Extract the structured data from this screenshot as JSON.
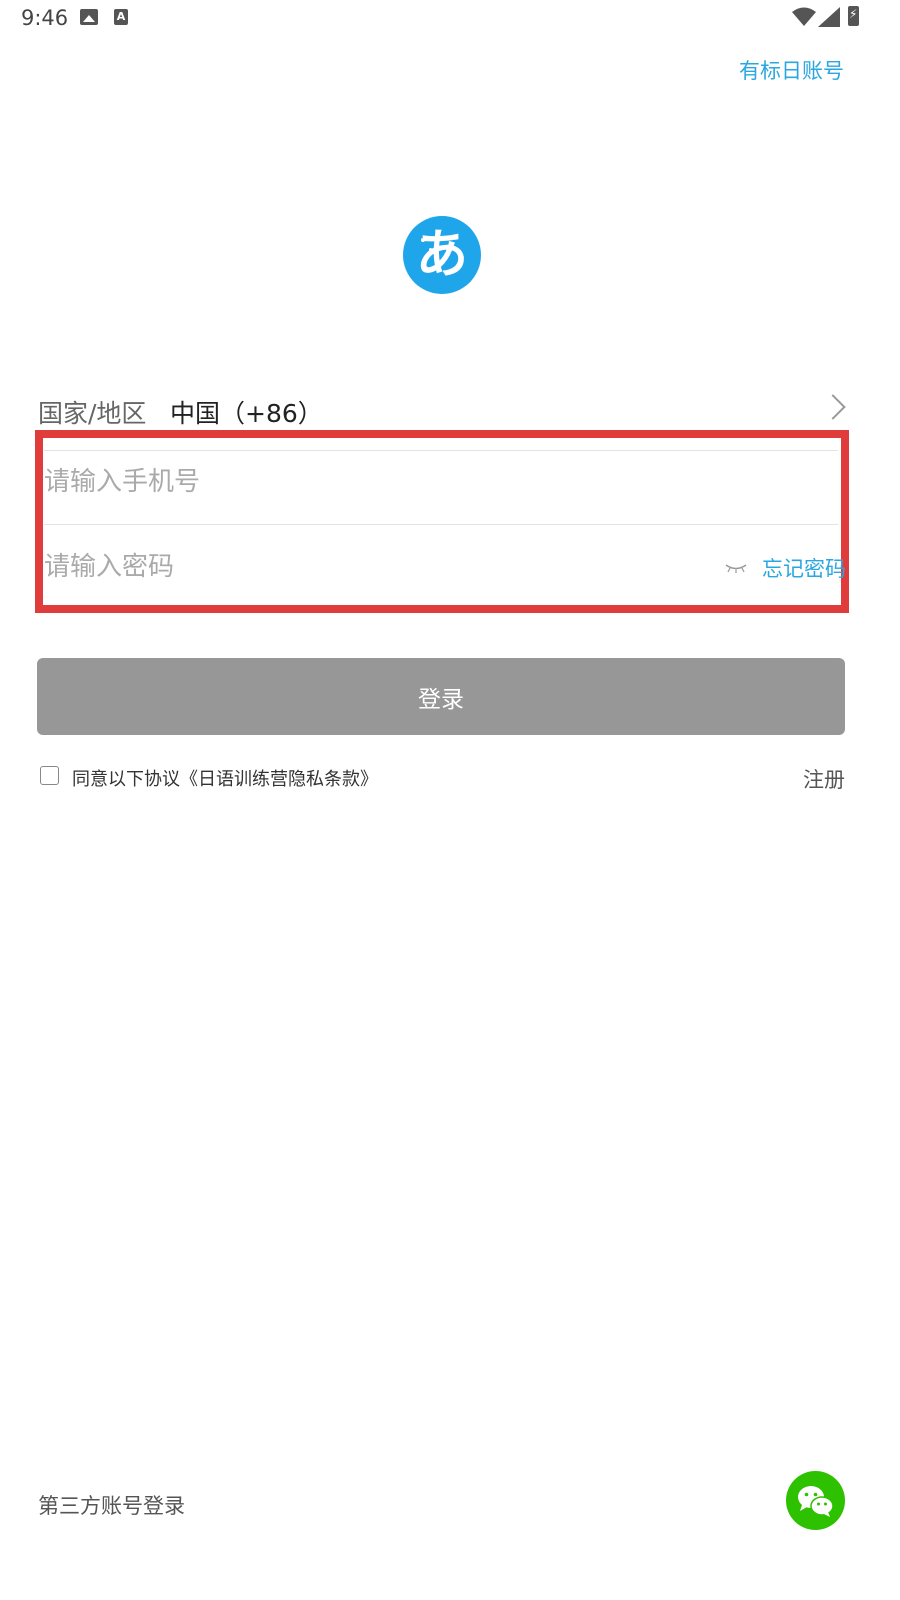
{
  "status_bar": {
    "time": "9:46",
    "icons": [
      "image-notification-icon",
      "a-notification-icon",
      "wifi-icon",
      "cellular-signal-icon",
      "battery-charging-icon"
    ]
  },
  "header": {
    "account_link": "有标日账号"
  },
  "logo": {
    "glyph": "あ",
    "color": "#1fa6ea"
  },
  "form": {
    "country_label": "国家/地区",
    "country_value": "中国（+86）",
    "phone": {
      "placeholder": "请输入手机号",
      "value": ""
    },
    "password": {
      "placeholder": "请输入密码",
      "value": "",
      "forgot_label": "忘记密码"
    },
    "login_label": "登录",
    "agreement_checked": false,
    "agreement_text": "同意以下协议《日语训练营隐私条款》",
    "register_label": "注册"
  },
  "third_party": {
    "label": "第三方账号登录",
    "providers": [
      "wechat-icon"
    ]
  },
  "colors": {
    "accent": "#2aa7e0",
    "login_button_bg": "#979797",
    "highlight_box": "#e13c3c",
    "wechat": "#2dc100"
  }
}
